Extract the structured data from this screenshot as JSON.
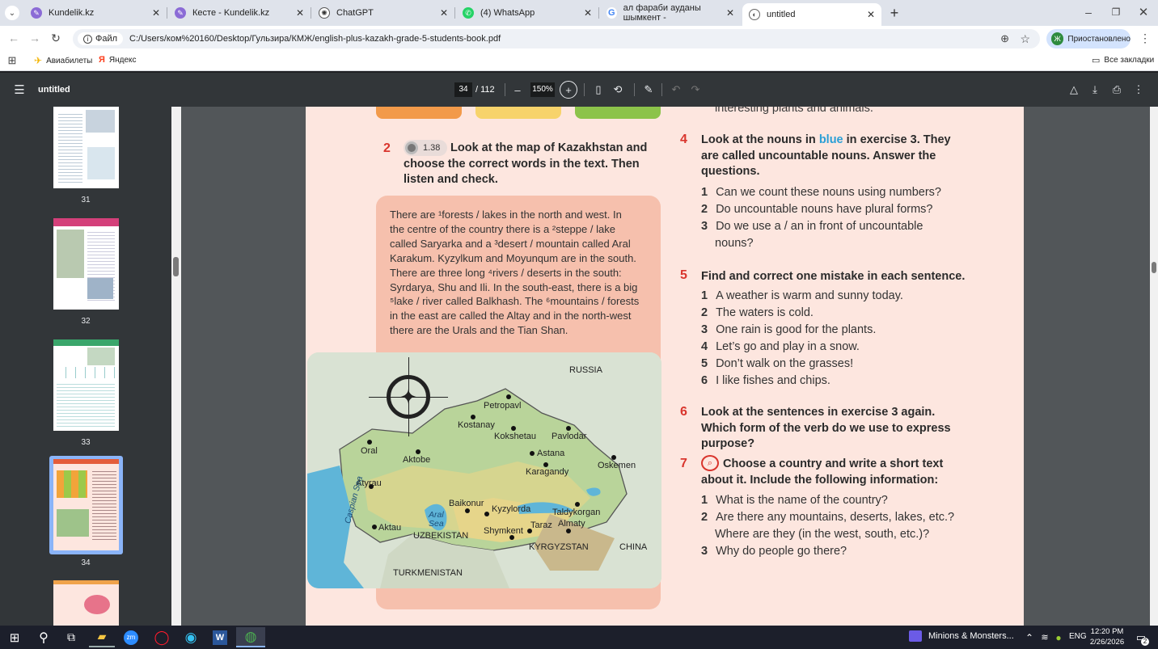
{
  "browser": {
    "tabs": [
      {
        "title": "Kundelik.kz"
      },
      {
        "title": "Кесте - Kundelik.kz"
      },
      {
        "title": "ChatGPT"
      },
      {
        "title": "(4) WhatsApp"
      },
      {
        "title": "ал фараби ауданы шымкент -"
      },
      {
        "title": "untitled"
      }
    ],
    "site_label": "Файл",
    "url": "C:/Users/ком%20160/Desktop/Гульзира/КМЖ/english-plus-kazakh-grade-5-students-book.pdf",
    "profile_initial": "Ж",
    "profile_status": "Приостановлено",
    "bookmarks": [
      {
        "label": "Авиабилеты"
      },
      {
        "label": "Яндекс"
      }
    ],
    "all_bookmarks": "Все закладки"
  },
  "pdf": {
    "title": "untitled",
    "current_page": "34",
    "total_pages": "/ 112",
    "zoom": "150%",
    "thumbnails": [
      "31",
      "32",
      "33",
      "34"
    ]
  },
  "page": {
    "ex2_number": "2",
    "ex2_audio": "1.38",
    "ex2_instruction": "Look at the map of Kazakhstan and choose the correct words in the text. Then listen and check.",
    "text_lines": [
      "There are ¹forests / lakes in the north and west. In",
      "the centre of the country there is a ²steppe / lake",
      "called Saryarka and a ³desert / mountain called Aral",
      "Karakum. Kyzylkum and Moyunqum are in the south.",
      "There are three long ⁴rivers / deserts in the south:",
      "Syrdarya, Shu and Ili. In the south-east, there is a big",
      "⁵lake / river called Balkhash. The ⁶mountains / forests",
      "in the east are called the Altay and in the north-west",
      "there are the Urals and the Tian Shan."
    ],
    "top_partial": "interesting plants and animals.",
    "ex4_number": "4",
    "ex4_instruction_a": "Look at the nouns in ",
    "ex4_blue": "blue",
    "ex4_instruction_b": " in exercise 3. They are called uncountable nouns. Answer the questions.",
    "ex4_items": [
      {
        "n": "1",
        "text": "Can we count these nouns using numbers?"
      },
      {
        "n": "2",
        "text": "Do uncountable nouns have plural forms?"
      },
      {
        "n": "3",
        "text": "Do we use a / an in front of uncountable nouns?"
      }
    ],
    "ex5_number": "5",
    "ex5_instruction": "Find and correct one mistake in each sentence.",
    "ex5_items": [
      {
        "n": "1",
        "text": "A weather is warm and sunny today."
      },
      {
        "n": "2",
        "text": "The waters is cold."
      },
      {
        "n": "3",
        "text": "One rain is good for the plants."
      },
      {
        "n": "4",
        "text": "Let’s go and play in a snow."
      },
      {
        "n": "5",
        "text": "Don’t walk on the grasses!"
      },
      {
        "n": "6",
        "text": "I like fishes and chips."
      }
    ],
    "ex6_number": "6",
    "ex6_instruction": "Look at the sentences in exercise 3 again. Which form of the verb do we use to express purpose?",
    "ex7_number": "7",
    "ex7_instruction": "Choose a country and write a short text about it. Include the following information:",
    "ex7_items": [
      {
        "n": "1",
        "text": "What is the name of the country?"
      },
      {
        "n": "2",
        "text": "Are there any mountains, deserts, lakes, etc.? Where are they (in the west, south, etc.)?"
      },
      {
        "n": "3",
        "text": "Why do people go there?"
      }
    ],
    "map_labels": {
      "russia": "RUSSIA",
      "petropavl": "Petropavl",
      "kostanay": "Kostanay",
      "kokshetau": "Kokshetau",
      "pavlodar": "Pavlodar",
      "oral": "Oral",
      "aktobe": "Aktobe",
      "astana": "Astana",
      "karagandy": "Karagandy",
      "oskemen": "Oskemen",
      "atyrau": "Atyrau",
      "baikonur": "Baikonur",
      "kyzylorda": "Kyzylorda",
      "taldykorgan": "Taldykorgan",
      "aral_sea": "Aral Sea",
      "almaty": "Almaty",
      "aktau": "Aktau",
      "uzbekistan": "UZBEKISTAN",
      "shymkent": "Shymkent",
      "taraz": "Taraz",
      "kyrgyzstan": "KYRGYZSTAN",
      "china": "CHINA",
      "caspian": "Caspian Sea",
      "turkmenistan": "TURKMENISTAN"
    }
  },
  "taskbar": {
    "media_title": "Minions & Monsters...",
    "language": "ENG",
    "time": "12:20 PM",
    "date": "2/26/2026",
    "notifications": "2"
  }
}
